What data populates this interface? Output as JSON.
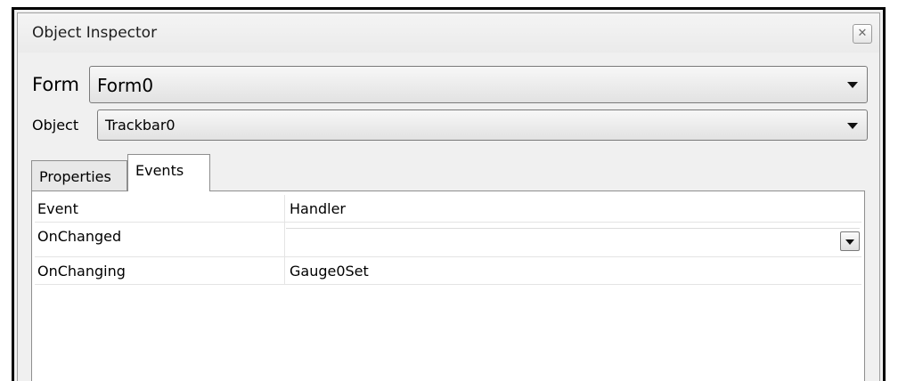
{
  "window": {
    "title": "Object Inspector",
    "close_icon": "close-icon"
  },
  "form_selector": {
    "label": "Form",
    "value": "Form0"
  },
  "object_selector": {
    "label": "Object",
    "value": "Trackbar0"
  },
  "tabs": [
    {
      "label": "Properties",
      "active": false
    },
    {
      "label": "Events",
      "active": true
    }
  ],
  "events_table": {
    "headers": [
      "Event",
      "Handler"
    ],
    "rows": [
      {
        "event": "OnChanged",
        "handler": ""
      },
      {
        "event": "OnChanging",
        "handler": "Gauge0Set"
      }
    ]
  }
}
